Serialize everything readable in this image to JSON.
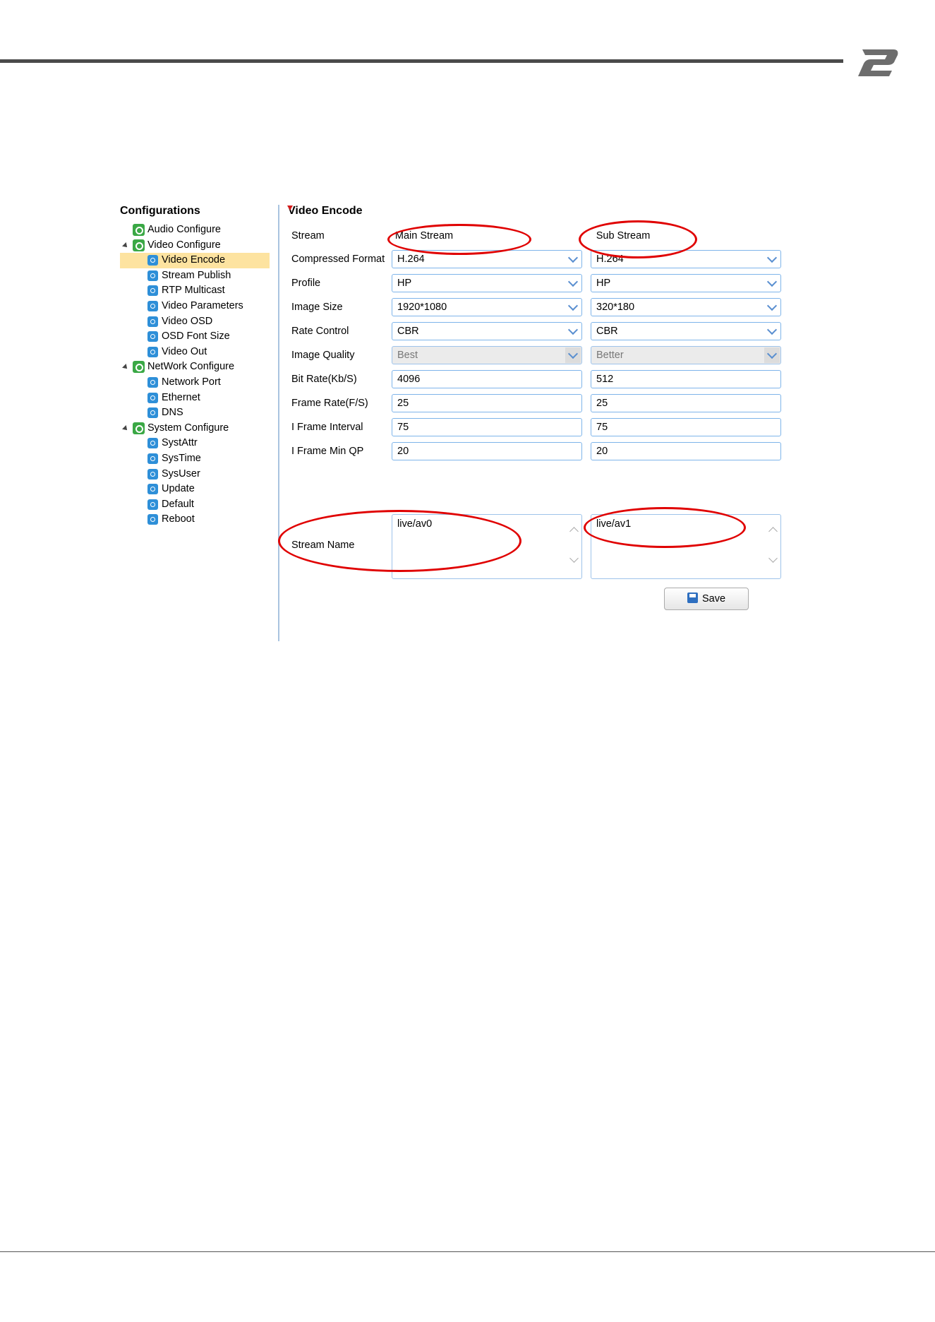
{
  "sidebar": {
    "title": "Configurations",
    "tree": [
      {
        "label": "Audio Configure",
        "level": 1,
        "expander": false,
        "icon": "gear-icon"
      },
      {
        "label": "Video Configure",
        "level": 1,
        "expander": true,
        "icon": "gear-icon"
      },
      {
        "label": "Video Encode",
        "level": 2,
        "selected": true,
        "icon": "settings-icon"
      },
      {
        "label": "Stream Publish",
        "level": 2,
        "icon": "settings-icon"
      },
      {
        "label": "RTP Multicast",
        "level": 2,
        "icon": "settings-icon"
      },
      {
        "label": "Video Parameters",
        "level": 2,
        "icon": "settings-icon"
      },
      {
        "label": "Video OSD",
        "level": 2,
        "icon": "settings-icon"
      },
      {
        "label": "OSD Font Size",
        "level": 2,
        "icon": "settings-icon"
      },
      {
        "label": "Video Out",
        "level": 2,
        "icon": "settings-icon"
      },
      {
        "label": "NetWork Configure",
        "level": 1,
        "expander": true,
        "icon": "gear-icon"
      },
      {
        "label": "Network Port",
        "level": 2,
        "icon": "settings-icon"
      },
      {
        "label": "Ethernet",
        "level": 2,
        "icon": "settings-icon"
      },
      {
        "label": "DNS",
        "level": 2,
        "icon": "settings-icon"
      },
      {
        "label": "System Configure",
        "level": 1,
        "expander": true,
        "icon": "gear-icon"
      },
      {
        "label": "SystAttr",
        "level": 2,
        "icon": "settings-icon"
      },
      {
        "label": "SysTime",
        "level": 2,
        "icon": "settings-icon"
      },
      {
        "label": "SysUser",
        "level": 2,
        "icon": "settings-icon"
      },
      {
        "label": "Update",
        "level": 2,
        "icon": "settings-icon"
      },
      {
        "label": "Default",
        "level": 2,
        "icon": "settings-icon"
      },
      {
        "label": "Reboot",
        "level": 2,
        "icon": "settings-icon"
      }
    ]
  },
  "main": {
    "title": "Video Encode",
    "stream_label": "Stream",
    "main_stream": "Main Stream",
    "sub_stream": "Sub Stream",
    "rows": [
      {
        "label": "Compressed Format",
        "type": "select",
        "main": "H.264",
        "sub": "H.264"
      },
      {
        "label": "Profile",
        "type": "select",
        "main": "HP",
        "sub": "HP"
      },
      {
        "label": "Image Size",
        "type": "select",
        "main": "1920*1080",
        "sub": "320*180"
      },
      {
        "label": "Rate Control",
        "type": "select",
        "main": "CBR",
        "sub": "CBR"
      },
      {
        "label": "Image Quality",
        "type": "select-disabled",
        "main": "Best",
        "sub": "Better"
      },
      {
        "label": "Bit Rate(Kb/S)",
        "type": "input",
        "main": "4096",
        "sub": "512"
      },
      {
        "label": "Frame Rate(F/S)",
        "type": "input",
        "main": "25",
        "sub": "25"
      },
      {
        "label": "I Frame Interval",
        "type": "input",
        "main": "75",
        "sub": "75"
      },
      {
        "label": "I Frame Min QP",
        "type": "input",
        "main": "20",
        "sub": "20"
      }
    ],
    "stream_name": {
      "label": "Stream Name",
      "main": "live/av0",
      "sub": "live/av1"
    },
    "save_label": "Save"
  },
  "colors": {
    "annotation": "#e00000",
    "selected_row": "#fde3a0",
    "input_border": "#7eb4ea"
  }
}
